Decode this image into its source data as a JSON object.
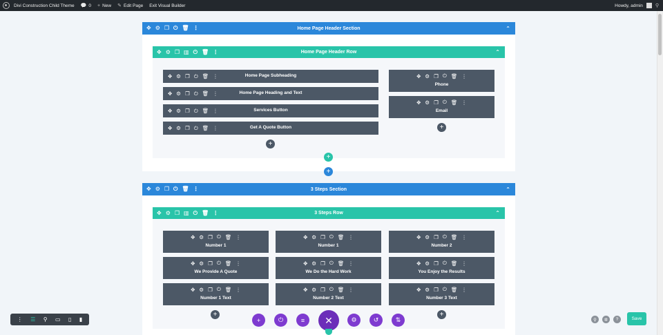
{
  "admin_bar": {
    "site_name": "Divi Construction Child Theme",
    "comments_count": "0",
    "new_label": "New",
    "edit_page_label": "Edit Page",
    "exit_label": "Exit Visual Builder",
    "howdy_label": "Howdy, admin"
  },
  "icons": {
    "move": "✥",
    "settings": "⚙",
    "duplicate": "❐",
    "columns": "▥",
    "power": "⏻",
    "trash": "🗑",
    "more": "⋮",
    "chevron_up": "⌃",
    "plus": "+",
    "close": "✕",
    "search": "⚲",
    "comment": "💬"
  },
  "sections": [
    {
      "title": "Home Page Header Section",
      "row_title": "Home Page Header Row",
      "column_1": [
        "Home Page Subheading",
        "Home Page Heading and Text",
        "Services Button",
        "Get A Quote Button"
      ],
      "column_2": [
        "Phone",
        "Email"
      ]
    },
    {
      "title": "3 Steps Section",
      "row_title": "3 Steps Row",
      "column_1": [
        "Number 1",
        "We Provide A Quote",
        "Number 1 Text"
      ],
      "column_2": [
        "Number 1",
        "We Do the Hard Work",
        "Number 2 Text"
      ],
      "column_3": [
        "Number 2",
        "You Enjoy the Results",
        "Number 3 Text"
      ]
    }
  ],
  "footer": {
    "save_label": "Save"
  },
  "colors": {
    "section": "#2b87da",
    "row": "#29c4a9",
    "module": "#4c5866",
    "builder_controls": "#7e3bd0"
  }
}
